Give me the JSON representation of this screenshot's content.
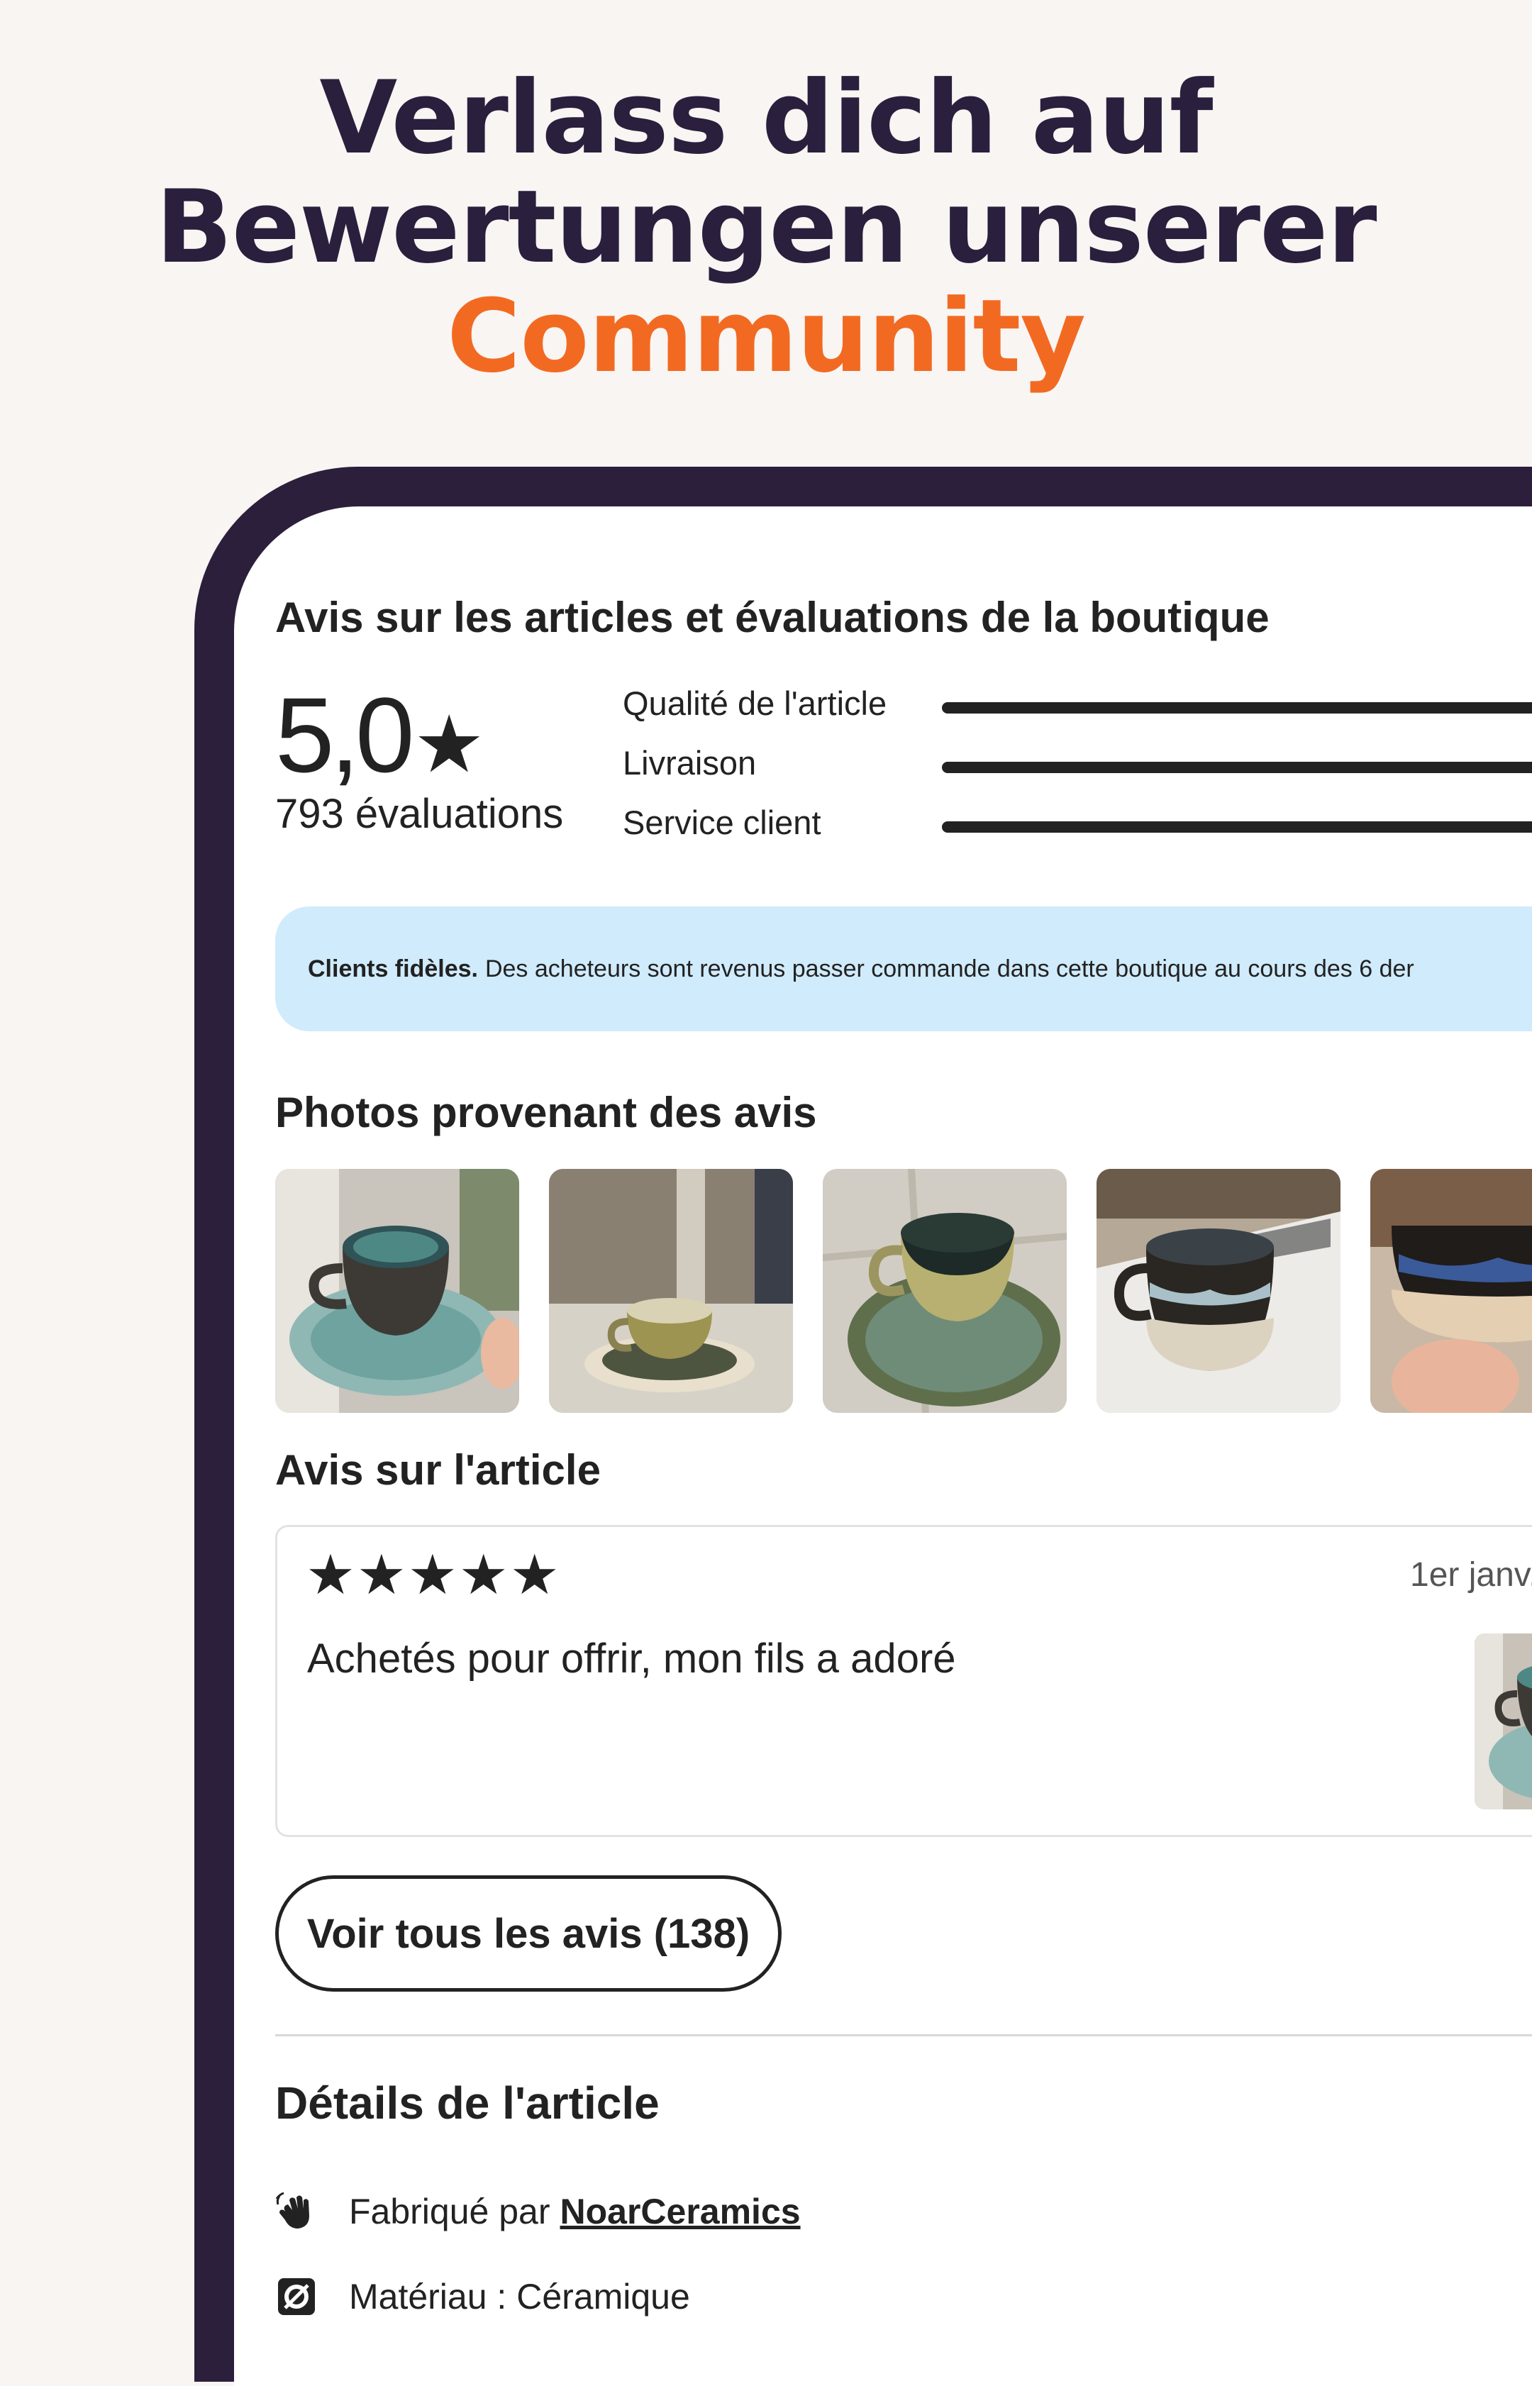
{
  "headline": {
    "line1": "Verlass dich auf",
    "line2": "Bewertungen unserer",
    "line3": "Community",
    "accent_color": "#f26a21"
  },
  "reviews_section": {
    "title": "Avis sur les articles et évaluations de la boutique",
    "rating": "5,0",
    "rating_count": "793 évaluations",
    "metrics": [
      {
        "label": "Qualité de l'article",
        "value": 5.0
      },
      {
        "label": "Livraison",
        "value": 5.0
      },
      {
        "label": "Service client",
        "value": 5.0
      }
    ]
  },
  "banner": {
    "bold": "Clients fidèles.",
    "text": "Des acheteurs sont revenus passer commande dans cette boutique au cours des 6 der"
  },
  "photos": {
    "title": "Photos provenant des avis",
    "items": [
      "cup-photo-1",
      "cup-photo-2",
      "cup-photo-3",
      "cup-photo-4",
      "cup-photo-5"
    ]
  },
  "item_review": {
    "title": "Avis sur l'article",
    "stars": "★★★★★",
    "star_count": 5,
    "date": "1er janv.",
    "text": "Achetés pour offrir, mon fils a adoré"
  },
  "see_all_button": "Voir tous les avis (138)",
  "details": {
    "title": "Détails de l'article",
    "made_by_prefix": "Fabriqué par",
    "shop_name": "NoarCeramics",
    "material": "Matériau : Céramique",
    "icons": [
      "hand-wave-icon",
      "material-icon"
    ]
  },
  "colors": {
    "background": "#f8f5f3",
    "device_frame": "#2c1f3b",
    "headline": "#2a1f3d",
    "banner": "#d0ebfb"
  }
}
